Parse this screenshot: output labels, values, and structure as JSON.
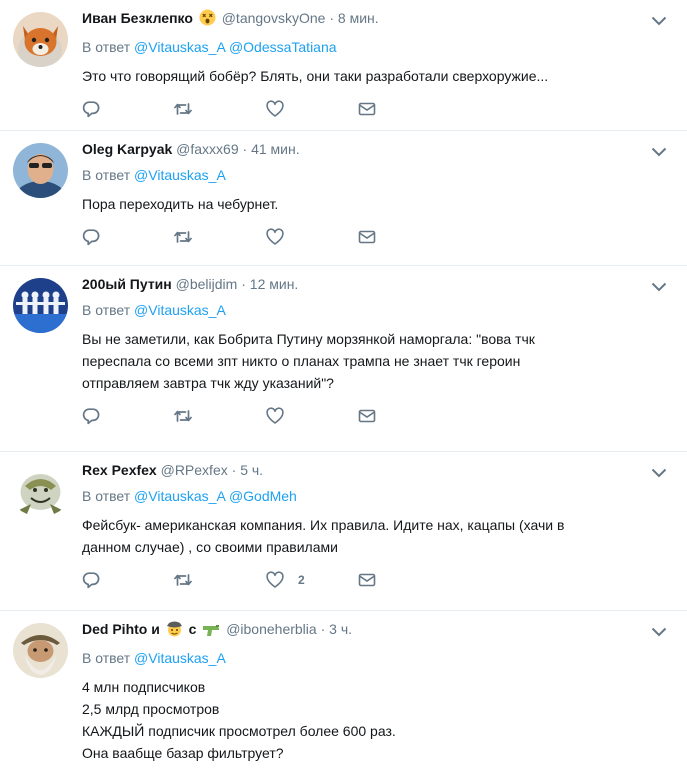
{
  "tweets": [
    {
      "name": "Иван Безклепко",
      "name_emoji": "😵",
      "handle": "@tangovskyOne",
      "sep": "·",
      "time": "8 мин.",
      "reply_prefix": "В ответ",
      "mentions": [
        "@Vitauskas_A",
        "@OdessaTatiana"
      ],
      "lines": [
        "Это что говорящий бобёр? Блять, они таки разработали сверхоружие..."
      ],
      "like_count": ""
    },
    {
      "name": "Oleg Karpyak",
      "handle": "@faxxx69",
      "sep": "·",
      "time": "41 мин.",
      "reply_prefix": "В ответ",
      "mentions": [
        "@Vitauskas_A"
      ],
      "lines": [
        "Пора переходить на чебурнет."
      ],
      "like_count": ""
    },
    {
      "name": "200ый Путин",
      "handle": "@belijdim",
      "sep": "·",
      "time": "12 мин.",
      "reply_prefix": "В ответ",
      "mentions": [
        "@Vitauskas_A"
      ],
      "lines": [
        "Вы не заметили, как Бобрита Путину морзянкой наморгала: \"вова тчк",
        "переспала со всеми зпт никто о планах трампа не знает тчк героин",
        "отправляем завтра тчк жду указаний\"?"
      ],
      "like_count": ""
    },
    {
      "name": "Rex Pexfex",
      "handle": "@RPexfex",
      "sep": "·",
      "time": "5 ч.",
      "reply_prefix": "В ответ",
      "mentions": [
        "@Vitauskas_A",
        "@GodMeh"
      ],
      "lines": [
        "Фейсбук- американская компания. Их правила. Идите нах, кацапы (хачи в",
        "данном случае) , со своими правилами"
      ],
      "like_count": "2"
    },
    {
      "name": "Ded Pihto и",
      "name_emoji": "🤠",
      "name_suffix": "с",
      "name_emoji2": "🔫",
      "handle": "@iboneherblia",
      "sep": "·",
      "time": "3 ч.",
      "reply_prefix": "В ответ",
      "mentions": [
        "@Vitauskas_A"
      ],
      "lines": [
        "4 млн подписчиков",
        "2,5 млрд просмотров",
        "КАЖДЫЙ подписчик просмотрел более 600 раз.",
        "Она ваабще базар фильтрует?"
      ],
      "like_count": ""
    }
  ],
  "icons": {
    "reply": "reply-icon",
    "retweet": "retweet-icon",
    "like": "like-icon",
    "dm": "direct-message-icon",
    "more": "chevron-down-icon"
  },
  "colors": {
    "link": "#1da1f2",
    "muted": "#657786",
    "text": "#14171a",
    "divider": "#e6ecf0"
  }
}
